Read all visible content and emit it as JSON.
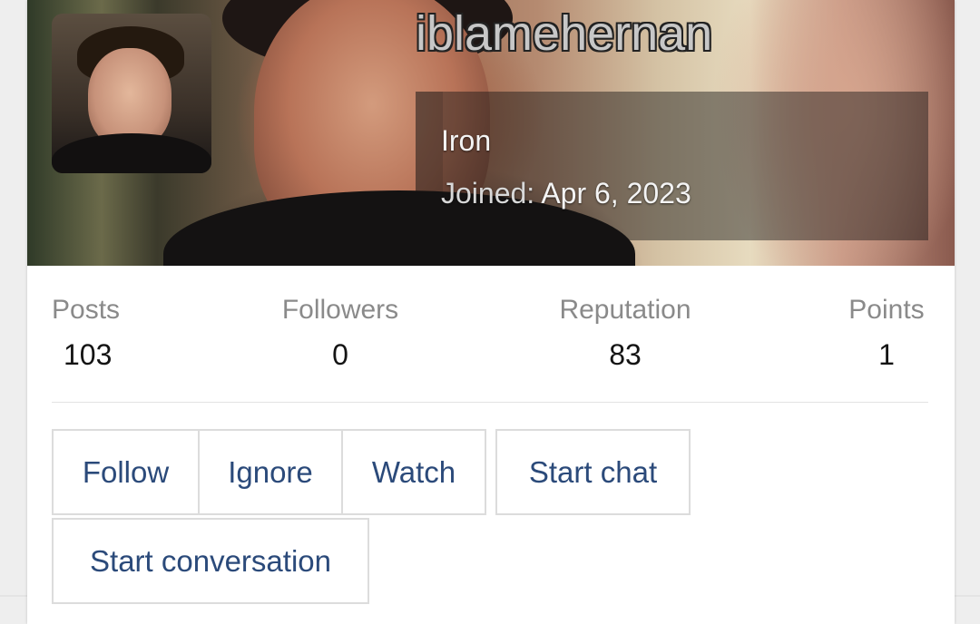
{
  "profile": {
    "username": "iblamehernan",
    "rank": "Iron",
    "joined_label": "Joined:",
    "joined_date": "Apr 6, 2023"
  },
  "stats": [
    {
      "label": "Posts",
      "value": "103"
    },
    {
      "label": "Followers",
      "value": "0"
    },
    {
      "label": "Reputation",
      "value": "83"
    },
    {
      "label": "Points",
      "value": "1"
    }
  ],
  "actions": {
    "follow": "Follow",
    "ignore": "Ignore",
    "watch": "Watch",
    "start_chat": "Start chat",
    "start_conversation": "Start conversation"
  },
  "colors": {
    "link": "#2b4a7a",
    "muted": "#8a8a8a",
    "border": "#dcdcdc"
  }
}
